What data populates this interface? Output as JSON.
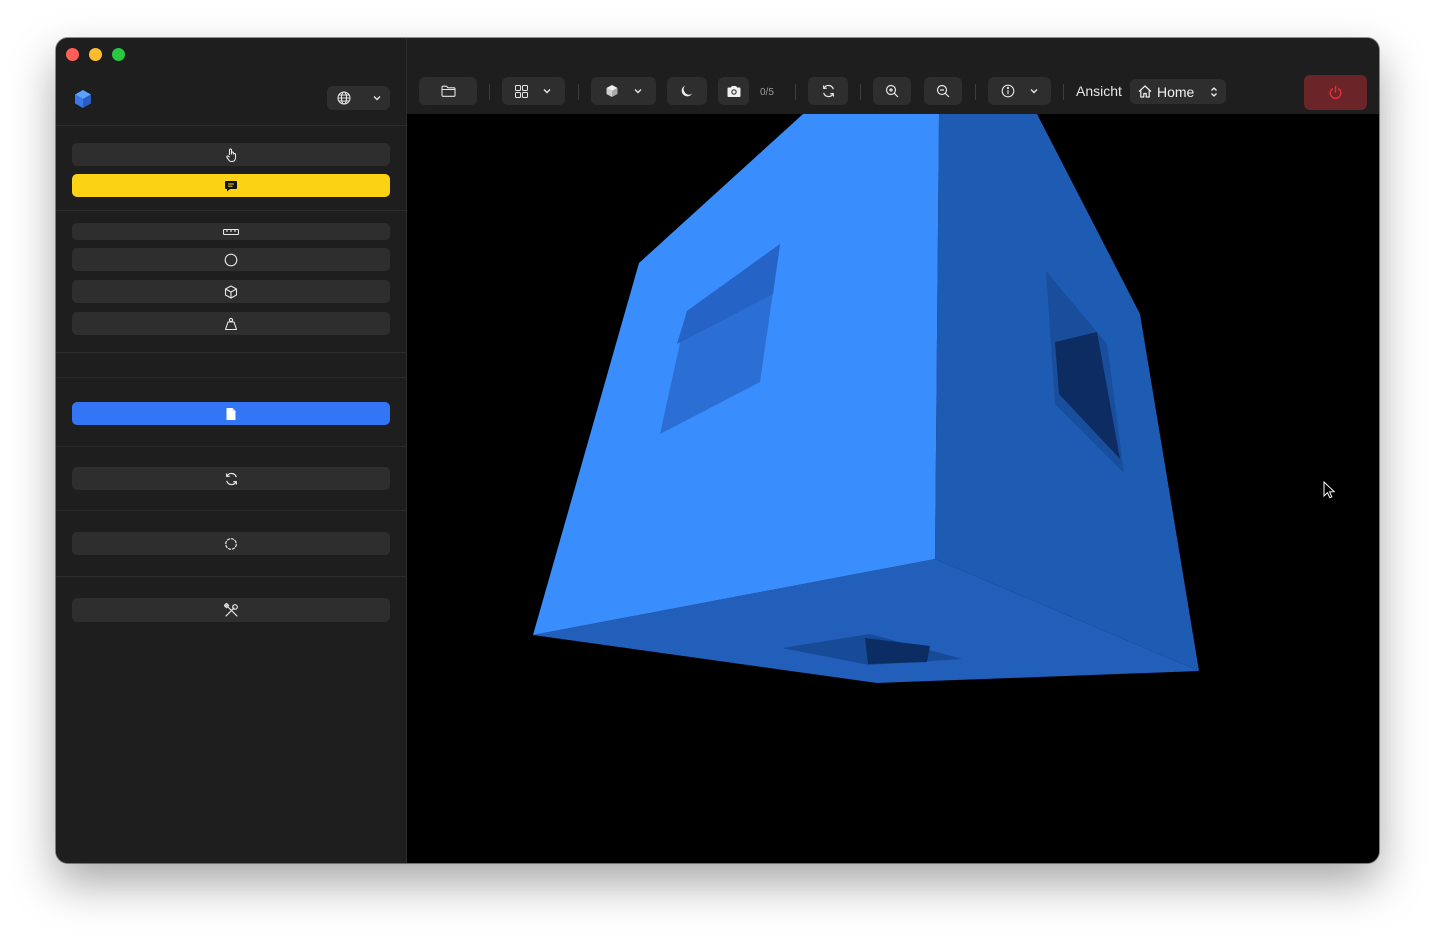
{
  "window": {
    "traffic_lights": [
      "close",
      "minimize",
      "zoom"
    ]
  },
  "sidebar": {
    "logo_icon": "cube-logo-icon",
    "language_icon": "globe-icon",
    "buttons": [
      {
        "icon": "hand-pointer-icon"
      },
      {
        "icon": "comment-icon",
        "color": "#fbd314"
      },
      {
        "icon": "ruler-icon"
      },
      {
        "icon": "circle-icon"
      },
      {
        "icon": "cube-outline-icon"
      },
      {
        "icon": "weight-icon"
      },
      {
        "icon": "file-icon",
        "color": "#3375f5"
      },
      {
        "icon": "refresh-icon"
      },
      {
        "icon": "gear-circle-icon"
      },
      {
        "icon": "tools-icon"
      }
    ]
  },
  "toolbar": {
    "screenshot_count": "0/5",
    "view_label": "Ansicht",
    "view_select": "Home",
    "power_color": "#e0323c"
  },
  "viewport": {
    "model_color": "#3a8dfc",
    "background": "#000000"
  }
}
